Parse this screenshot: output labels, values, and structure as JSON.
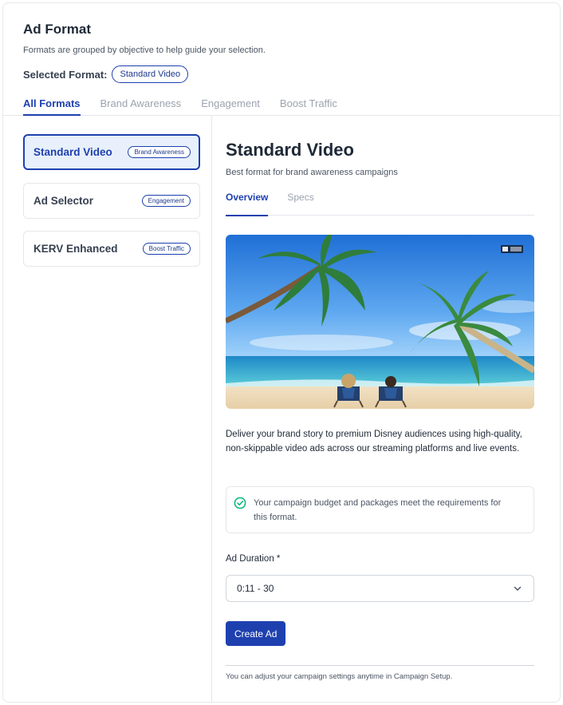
{
  "header": {
    "title": "Ad Format",
    "subtitle": "Formats are grouped by objective to help guide your selection.",
    "selected_label": "Selected Format:",
    "selected_value": "Standard Video"
  },
  "tabs": [
    {
      "label": "All Formats",
      "active": true
    },
    {
      "label": "Brand Awareness",
      "active": false
    },
    {
      "label": "Engagement",
      "active": false
    },
    {
      "label": "Boost Traffic",
      "active": false
    }
  ],
  "formats": [
    {
      "name": "Standard Video",
      "badge": "Brand Awareness",
      "active": true
    },
    {
      "name": "Ad Selector",
      "badge": "Engagement",
      "active": false
    },
    {
      "name": "KERV Enhanced",
      "badge": "Boost Traffic",
      "active": false
    }
  ],
  "detail": {
    "title": "Standard Video",
    "subtitle": "Best format for brand awareness campaigns",
    "tabs": [
      {
        "label": "Overview",
        "active": true
      },
      {
        "label": "Specs",
        "active": false
      }
    ],
    "media_icon": "ad-badge-icon",
    "description": "Deliver your brand story to premium Disney audiences using high-quality, non-skippable video ads across our streaming platforms and live events.",
    "notice": "Your campaign budget and packages meet the requirements for this format.",
    "notice_icon": "check-circle-icon",
    "duration_label": "Ad Duration *",
    "duration_value": "0:11 - 30",
    "create_label": "Create Ad",
    "footnote": "You can adjust your campaign settings anytime in Campaign Setup."
  },
  "colors": {
    "accent": "#1e40af",
    "active_bg": "#e8f0fb",
    "success": "#10b981"
  }
}
